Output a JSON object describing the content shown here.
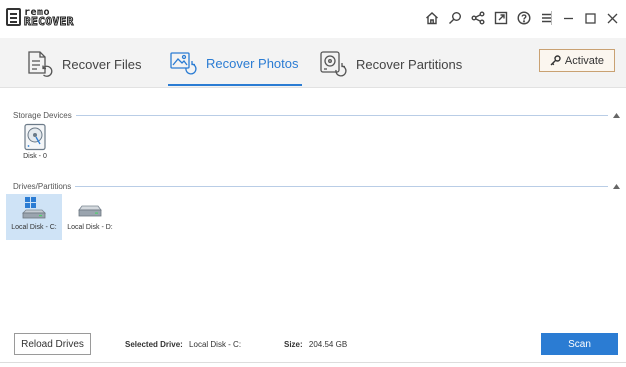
{
  "app": {
    "logo_top": "remo",
    "logo_bottom": "RECOVER"
  },
  "titlebar": {
    "icons": [
      "home-icon",
      "search-icon",
      "share-icon",
      "external-link-icon",
      "help-icon",
      "menu-icon"
    ],
    "window_controls": [
      "minimize-icon",
      "maximize-icon",
      "close-icon"
    ]
  },
  "tabs": [
    {
      "label": "Recover Files",
      "icon": "recover-files-icon",
      "active": false
    },
    {
      "label": "Recover Photos",
      "icon": "recover-photos-icon",
      "active": true
    },
    {
      "label": "Recover Partitions",
      "icon": "recover-partitions-icon",
      "active": false
    }
  ],
  "activate_label": "Activate",
  "storage_devices": {
    "title": "Storage Devices",
    "items": [
      {
        "label": "Disk - 0",
        "icon": "hard-disk-icon"
      }
    ]
  },
  "drives": {
    "title": "Drives/Partitions",
    "items": [
      {
        "label": "Local Disk - C:",
        "icon": "windows-drive-icon",
        "selected": true
      },
      {
        "label": "Local Disk - D:",
        "icon": "drive-icon",
        "selected": false
      }
    ]
  },
  "footer": {
    "reload_label": "Reload Drives",
    "selected_drive_label": "Selected Drive:",
    "selected_drive_value": "Local Disk - C:",
    "size_label": "Size:",
    "size_value": "204.54 GB",
    "scan_label": "Scan"
  },
  "colors": {
    "accent": "#2b7cd3",
    "selected_bg": "#cfe3f6",
    "activate_border": "#c9a172"
  }
}
